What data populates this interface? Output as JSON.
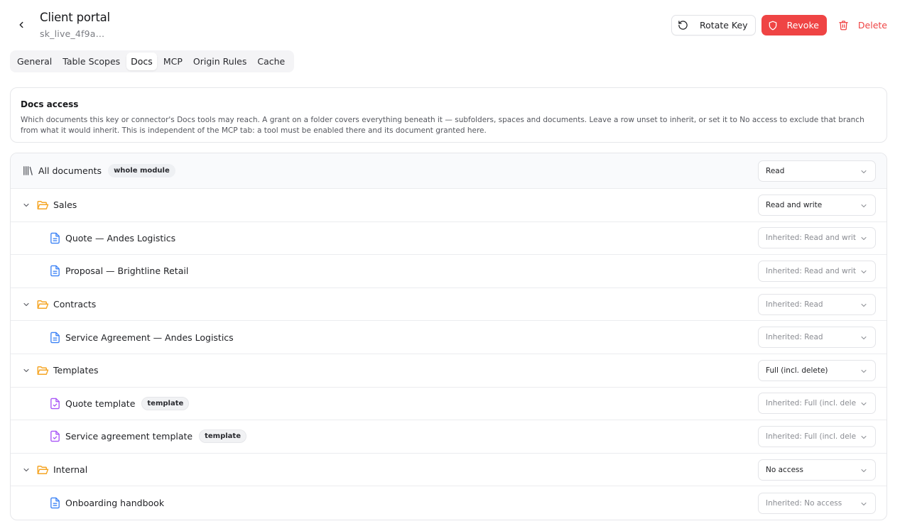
{
  "header": {
    "title": "Client portal",
    "subtitle": "sk_live_4f9a…",
    "actions": {
      "rotate_label": "Rotate Key",
      "revoke_label": "Revoke",
      "delete_label": "Delete"
    }
  },
  "tabs": [
    {
      "label": "General",
      "active": false
    },
    {
      "label": "Table Scopes",
      "active": false
    },
    {
      "label": "Docs",
      "active": true
    },
    {
      "label": "MCP",
      "active": false
    },
    {
      "label": "Origin Rules",
      "active": false
    },
    {
      "label": "Cache",
      "active": false
    }
  ],
  "info": {
    "title": "Docs access",
    "description": "Which documents this key or connector's Docs tools may reach. A grant on a folder covers everything beneath it — subfolders, spaces and documents. Leave a row unset to inherit, or set it to No access to exclude that branch from what it would inherit. This is independent of the MCP tab: a tool must be enabled there and its document granted here."
  },
  "tree": {
    "root": {
      "label": "All documents",
      "badge": "whole module",
      "value": "Read"
    },
    "groups": [
      {
        "label": "Sales",
        "value": "Read and write",
        "children": [
          {
            "label": "Quote — Andes Logistics",
            "value": "Inherited: Read and write"
          },
          {
            "label": "Proposal — Brightline Retail",
            "value": "Inherited: Read and write"
          }
        ]
      },
      {
        "label": "Contracts",
        "value": "Inherited: Read",
        "children": [
          {
            "label": "Service Agreement — Andes Logistics",
            "value": "Inherited: Read"
          }
        ]
      },
      {
        "label": "Templates",
        "value": "Full (incl. delete)",
        "children": [
          {
            "label": "Quote template",
            "badge": "template",
            "value": "Inherited: Full (incl. delete)"
          },
          {
            "label": "Service agreement template",
            "badge": "template",
            "value": "Inherited: Full (incl. delete)"
          }
        ]
      },
      {
        "label": "Internal",
        "value": "No access",
        "children": [
          {
            "label": "Onboarding handbook",
            "value": "Inherited: No access"
          }
        ]
      }
    ]
  },
  "colors": {
    "danger": "#ef4444",
    "folder": "#f5a524",
    "doc": "#3b82f6",
    "template_doc": "#a855f7"
  },
  "icons": {
    "back": "chevron-left-icon",
    "rotate": "rotate-ccw-icon",
    "revoke": "shield-icon",
    "delete": "trash-icon",
    "root": "library-icon",
    "folder": "folder-open-icon",
    "doc": "file-text-icon",
    "template": "file-check-icon",
    "expand": "chevron-down-icon"
  }
}
